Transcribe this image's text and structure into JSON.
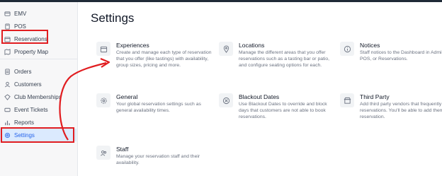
{
  "sidebar": {
    "items": [
      {
        "label": "EMV",
        "icon": "card-icon"
      },
      {
        "label": "POS",
        "icon": "pos-icon"
      },
      {
        "label": "Reservations",
        "icon": "reservations-icon"
      },
      {
        "label": "Property Map",
        "icon": "map-icon"
      },
      {
        "label": "Orders",
        "icon": "orders-icon"
      },
      {
        "label": "Customers",
        "icon": "customers-icon"
      },
      {
        "label": "Club Memberships",
        "icon": "club-icon"
      },
      {
        "label": "Event Tickets",
        "icon": "ticket-icon"
      },
      {
        "label": "Reports",
        "icon": "reports-icon"
      },
      {
        "label": "Settings",
        "icon": "gear-icon"
      }
    ],
    "active": "Settings"
  },
  "page": {
    "title": "Settings"
  },
  "cards": [
    {
      "title": "Experiences",
      "desc": "Create and manage each type of reservation that you offer (like tastings) with availability, group sizes, pricing and more.",
      "icon": "calendar-icon"
    },
    {
      "title": "Locations",
      "desc": "Manage the different areas that you offer reservations such as a tasting bar or patio, and configure seating options for each.",
      "icon": "location-pin-icon"
    },
    {
      "title": "Notices",
      "desc": "Staff notices to the Dashboard in Admin, POS, or Reservations.",
      "icon": "info-icon"
    },
    {
      "title": "General",
      "desc": "Your global reservation settings such as general availability times.",
      "icon": "gear-icon"
    },
    {
      "title": "Blackout Dates",
      "desc": "Use Blackout Dates to override and block days that customers are not able to book reservations.",
      "icon": "blocked-icon"
    },
    {
      "title": "Third Party",
      "desc": "Add third party vendors that frequently book reservations. You'll be able to add them to a reservation.",
      "icon": "store-icon"
    },
    {
      "title": "Staff",
      "desc": "Manage your reservation staff and their availability.",
      "icon": "staff-icon"
    }
  ],
  "colors": {
    "accent": "#2563eb",
    "highlight": "#e11d20",
    "active_bg": "#dbeafe"
  }
}
